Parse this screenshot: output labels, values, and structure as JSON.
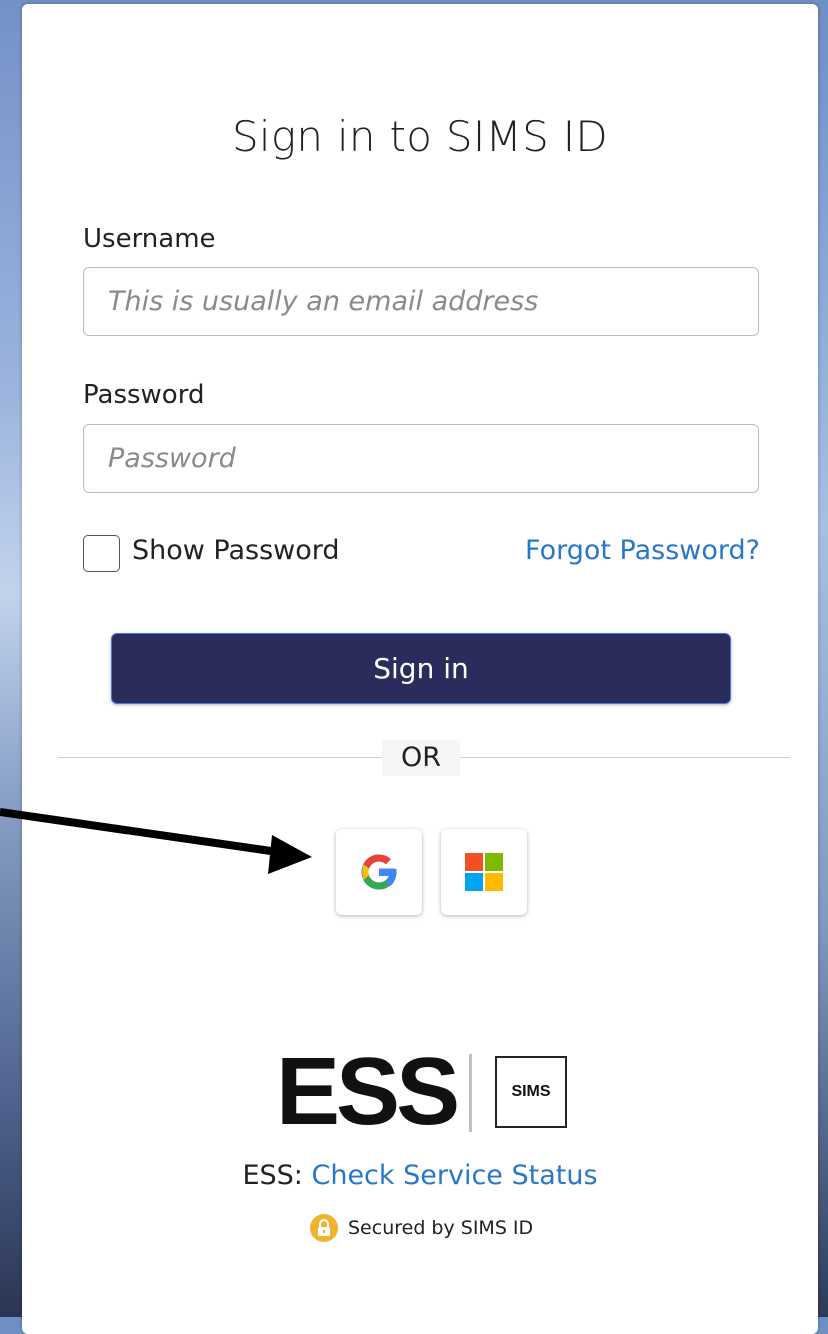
{
  "login": {
    "title": "Sign in to SIMS ID",
    "username_label": "Username",
    "username_placeholder": "This is usually an email address",
    "password_label": "Password",
    "password_placeholder": "Password",
    "show_password_label": "Show Password",
    "show_password_checked": false,
    "forgot_password_link": "Forgot Password?",
    "signin_button": "Sign in",
    "divider_text": "OR"
  },
  "sso_providers": [
    {
      "name": "Google",
      "icon": "google-icon"
    },
    {
      "name": "Microsoft",
      "icon": "microsoft-icon"
    }
  ],
  "footer": {
    "ess_logo": "ESS",
    "sims_logo": "SIMS",
    "status_prefix": "ESS:",
    "status_link": "Check Service Status",
    "secured_text": "Secured by SIMS ID"
  },
  "colors": {
    "signin_button": "#2a2d5c",
    "link": "#2a77c9",
    "lock_badge": "#f2b32c"
  }
}
